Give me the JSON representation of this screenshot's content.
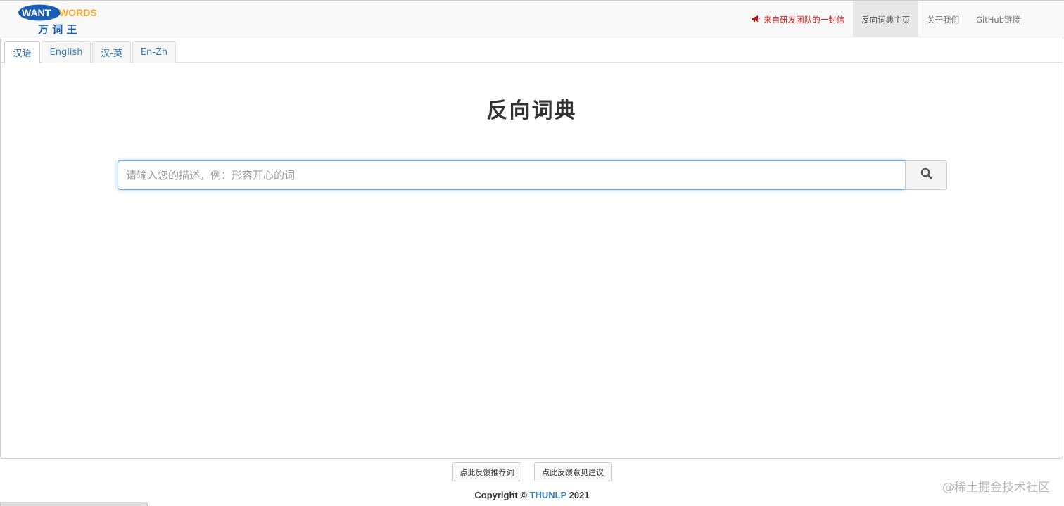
{
  "logo": {
    "word_white": "WANT",
    "word_orange": "WORDS",
    "cn": "万 词 王"
  },
  "nav": {
    "letter": "来自研发团队的一封信",
    "home": "反向词典主页",
    "about": "关于我们",
    "github": "GitHub链接"
  },
  "tabs": [
    "汉语",
    "English",
    "汉-英",
    "En-Zh"
  ],
  "active_tab": "汉语",
  "main": {
    "title": "反向词典",
    "search_placeholder": "请输入您的描述，例：形容开心的词"
  },
  "footer": {
    "feedback_words": "点此反馈推荐词",
    "feedback_suggestions": "点此反馈意见建议",
    "copyright_prefix": "Copyright ©",
    "copyright_org": "THUNLP",
    "copyright_year": "2021"
  },
  "watermark": "@稀土掘金技术社区",
  "colors": {
    "link_blue": "#337ab7",
    "letter_red": "#d21a1a",
    "logo_blue": "#1a5fb4",
    "logo_orange": "#f5a623",
    "focus_blue": "#66afe9"
  },
  "icons": {
    "search": "search-icon",
    "megaphone": "megaphone-icon"
  }
}
